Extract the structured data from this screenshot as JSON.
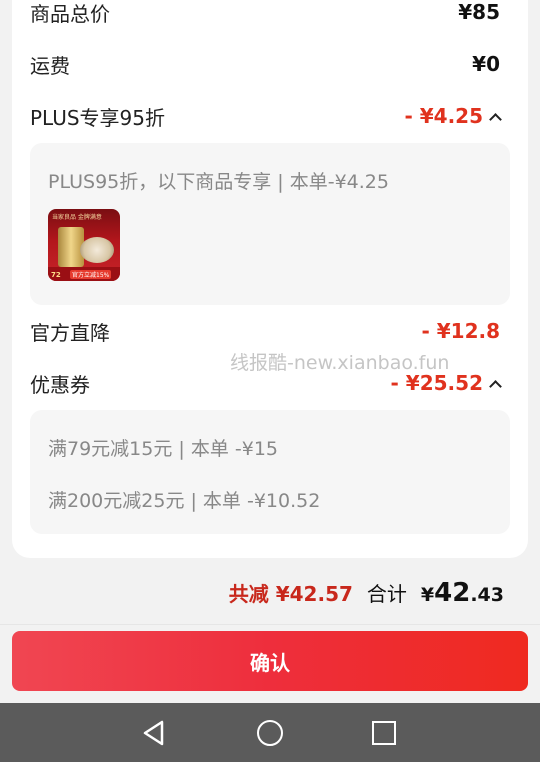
{
  "rows": {
    "goods_total": {
      "label": "商品总价",
      "value": "¥85"
    },
    "shipping": {
      "label": "运费",
      "value": "¥0"
    },
    "plus": {
      "label": "PLUS专享95折",
      "value": "- ¥4.25"
    },
    "official": {
      "label": "官方直降",
      "value": "- ¥12.8"
    },
    "coupon": {
      "label": "优惠券",
      "value": "- ¥25.52"
    }
  },
  "plus_detail": {
    "text": "PLUS95折，以下商品专享 | 本单-¥4.25",
    "product_thumb": {
      "header": "当家良品 金牌满意",
      "price": "72",
      "tag": "官方立减15%"
    }
  },
  "coupon_detail": {
    "items": [
      "满79元减15元 | 本单 -¥15",
      "满200元减25元 | 本单 -¥10.52"
    ]
  },
  "watermark": "线报酷-new.xianbao.fun",
  "summary": {
    "saved": "共减 ¥42.57",
    "total_label": "合计",
    "total_currency": "¥",
    "total_int": "42",
    "total_dec": ".43"
  },
  "confirm_label": "确认",
  "colors": {
    "accent": "#e0321e",
    "button_start": "#f04652",
    "button_end": "#ef2a20",
    "navbar": "#5b5b5b"
  },
  "icons": {
    "nav_back": "triangle-back-icon",
    "nav_home": "circle-home-icon",
    "nav_recent": "square-recent-icon",
    "collapse": "chevron-up-icon"
  }
}
